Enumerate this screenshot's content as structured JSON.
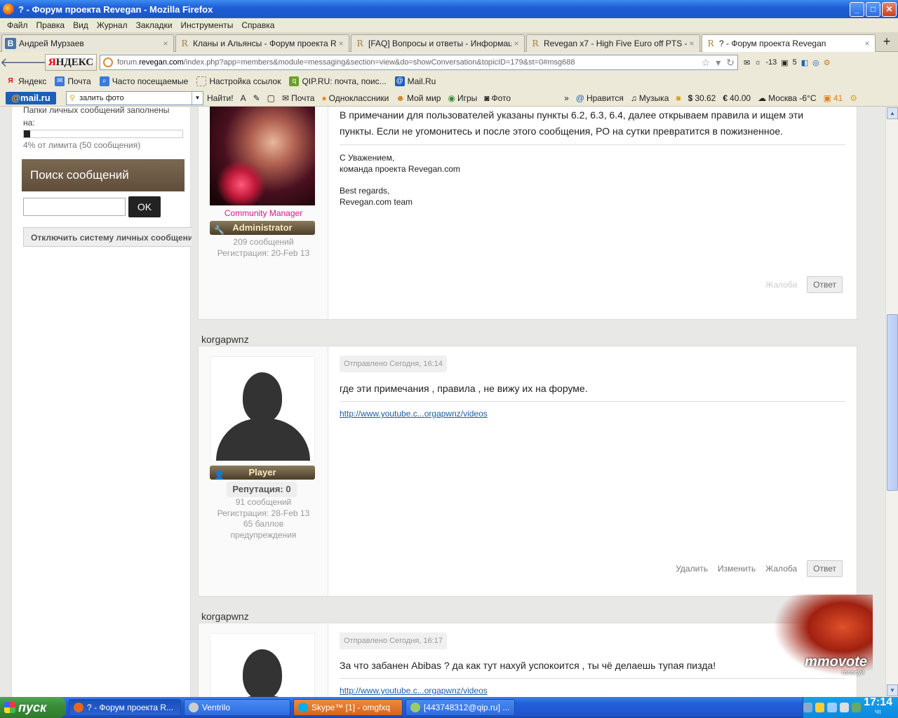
{
  "window": {
    "title": "? - Форум проекта Revegan - Mozilla Firefox",
    "minimize_glyph": "_",
    "maximize_glyph": "□",
    "close_glyph": "✕"
  },
  "menu": [
    "Файл",
    "Правка",
    "Вид",
    "Журнал",
    "Закладки",
    "Инструменты",
    "Справка"
  ],
  "tabs": [
    {
      "icon": "B",
      "label": "Андрей Мурзаев",
      "active": false
    },
    {
      "icon": "R",
      "label": "Кланы и Альянсы - Форум проекта Rev...",
      "active": false
    },
    {
      "icon": "R",
      "label": "[FAQ] Вопросы и ответы - Информация...",
      "active": false
    },
    {
      "icon": "R",
      "label": "Revegan x7 - High Five Euro off PTS - O...",
      "active": false
    },
    {
      "icon": "R",
      "label": "? - Форум проекта Revegan",
      "active": true
    }
  ],
  "tab_close_glyph": "×",
  "new_tab_glyph": "+",
  "nav": {
    "back_glyph": "🡐",
    "forward_glyph": "🡒",
    "yandex_first": "Я",
    "yandex_rest": "НДЕКС",
    "url_prefix": "forum.",
    "url_domain": "revegan.com",
    "url_rest": "/index.php?app=members&module=messaging&section=view&do=showConversation&topicID=179&st=0#msg688",
    "url_tools": [
      "☆",
      "▾",
      "↻"
    ],
    "weather_temp": "-13",
    "mail_count": "5"
  },
  "bookmarks": [
    "Яндекс",
    "Почта",
    "Часто посещаемые",
    "Настройка ссылок",
    "QIP.RU: почта, поис...",
    "Mail.Ru"
  ],
  "mailru_toolbar": {
    "logo_at": "@",
    "logo_text": "mail.ru",
    "search_value": "залить фото",
    "search_button": "Найти!",
    "items": [
      "Почта",
      "Одноклассники",
      "Мой мир",
      "Игры",
      "Фото"
    ],
    "more_glyph": "»",
    "right_items": [
      "Нравится",
      "Музыка"
    ],
    "dollar": "30.62",
    "euro": "40.00",
    "weather": "Москва -6°C",
    "count": "41"
  },
  "sidebar": {
    "quota_label_line1": "Папки личных сообщений заполнены",
    "quota_label_line2": "на:",
    "quota_fraction": 0.04,
    "quota_text": "4% от лимита (50 сообщения)",
    "search_title": "Поиск сообщений",
    "search_button": "OK",
    "disable_button": "Отключить систему личных сообщений"
  },
  "posts": [
    {
      "author": "",
      "rank_title": "Community Manager",
      "group": "Administrator",
      "group_icon": "🔧",
      "posts_count": "209 сообщений",
      "registered": "Регистрация: 20-Feb 13",
      "text_line1": "В примечании для пользователей указаны пункты 6.2, 6.3, 6.4, далее открываем правила и ищем эти",
      "text_line2": "пункты. Если не угомонитесь и после этого сообщения, РО на сутки превратится в пожизненное.",
      "sig_lines": [
        "С Уважением,",
        "команда проекта Revegan.com",
        "",
        "Best regards,",
        "Revegan.com team"
      ],
      "actions": {
        "report": "Жалоба",
        "reply": "Ответ"
      }
    },
    {
      "author": "korgapwnz",
      "sent": "Отправлено Сегодня, 16:14",
      "group": "Player",
      "group_icon": "👤",
      "reputation": "Репутация: 0",
      "posts_count": "91 сообщений",
      "registered": "Регистрация: 28-Feb 13",
      "warn_line1": "65 баллов",
      "warn_line2": "предупреждения",
      "text": "где эти примечания , правила , не вижу их на форуме.",
      "sig_link": "http://www.youtube.c...orgapwnz/videos",
      "actions": {
        "delete": "Удалить",
        "edit": "Изменить",
        "report": "Жалоба",
        "reply": "Ответ"
      }
    },
    {
      "author": "korgapwnz",
      "sent": "Отправлено Сегодня, 16:17",
      "text": "За что забанен Abibas ? да как тут нахуй успокоится , ты чё делаешь тупая пизда!",
      "sig_link": "http://www.youtube.c...orgapwnz/videos"
    }
  ],
  "ad": {
    "title": "mmovote",
    "subtitle": "голосуй"
  },
  "scrollbar": {
    "up_glyph": "▲",
    "down_glyph": "▼"
  },
  "taskbar": {
    "start": "пуск",
    "tasks": [
      "? - Форум проекта R...",
      "Ventrilo",
      "Skype™ [1] - omgfxq",
      "[443748312@qip.ru] ..."
    ],
    "time": "17:14",
    "day": "Чт"
  },
  "colors": {
    "rank_title": "#e0168c",
    "link": "#1a5faa",
    "xp_blue": "#245edb"
  }
}
